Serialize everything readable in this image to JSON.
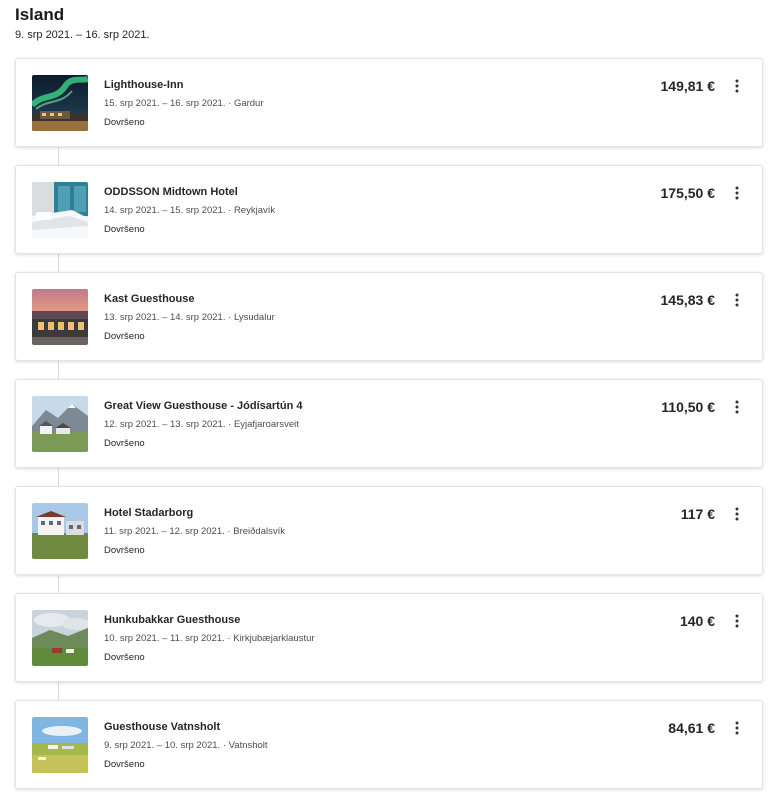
{
  "trip": {
    "title": "Island",
    "dates": "9. srp 2021. – 16. srp 2021."
  },
  "bookings": [
    {
      "name": "Lighthouse-Inn",
      "dates": "15. srp 2021. – 16. srp 2021.",
      "separator": "·",
      "location": "Gardur",
      "status": "Dovršeno",
      "price": "149,81 €",
      "thumb": "aurora-photo"
    },
    {
      "name": "ODDSSON Midtown Hotel",
      "dates": "14. srp 2021. – 15. srp 2021.",
      "separator": "·",
      "location": "Reykjavík",
      "status": "Dovršeno",
      "price": "175,50 €",
      "thumb": "hotel-room-photo"
    },
    {
      "name": "Kast Guesthouse",
      "dates": "13. srp 2021. – 14. srp 2021.",
      "separator": "·",
      "location": "Lysudalur",
      "status": "Dovršeno",
      "price": "145,83 €",
      "thumb": "sunset-building-photo"
    },
    {
      "name": "Great View Guesthouse - Jódísartún 4",
      "dates": "12. srp 2021. – 13. srp 2021.",
      "separator": "·",
      "location": "Eyjafjaroarsveit",
      "status": "Dovršeno",
      "price": "110,50 €",
      "thumb": "mountain-houses-photo"
    },
    {
      "name": "Hotel Stadarborg",
      "dates": "11. srp 2021. – 12. srp 2021.",
      "separator": "·",
      "location": "Breiðdalsvík",
      "status": "Dovršeno",
      "price": "117 €",
      "thumb": "hotel-exterior-photo"
    },
    {
      "name": "Hunkubakkar Guesthouse",
      "dates": "10. srp 2021. – 11. srp 2021.",
      "separator": "·",
      "location": "Kirkjubæjarklaustur",
      "status": "Dovršeno",
      "price": "140 €",
      "thumb": "green-valley-photo"
    },
    {
      "name": "Guesthouse Vatnsholt",
      "dates": "9. srp 2021. – 10. srp 2021.",
      "separator": "·",
      "location": "Vatnsholt",
      "status": "Dovršeno",
      "price": "84,61 €",
      "thumb": "field-farm-photo"
    }
  ]
}
